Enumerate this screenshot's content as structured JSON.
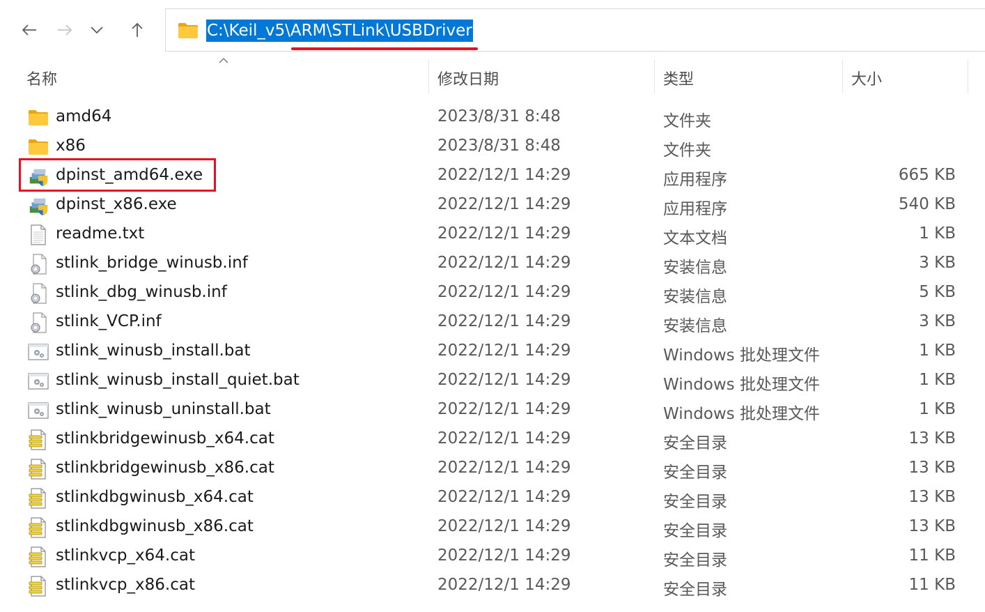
{
  "address_bar": {
    "path": "C:\\Keil_v5\\ARM\\STLink\\USBDriver"
  },
  "columns": {
    "name": "名称",
    "date": "修改日期",
    "type": "类型",
    "size": "大小"
  },
  "files": [
    {
      "name": "amd64",
      "date": "2023/8/31 8:48",
      "type": "文件夹",
      "size": "",
      "icon": "folder-icon"
    },
    {
      "name": "x86",
      "date": "2023/8/31 8:48",
      "type": "文件夹",
      "size": "",
      "icon": "folder-icon"
    },
    {
      "name": "dpinst_amd64.exe",
      "date": "2022/12/1 14:29",
      "type": "应用程序",
      "size": "665 KB",
      "icon": "installer-exe-icon"
    },
    {
      "name": "dpinst_x86.exe",
      "date": "2022/12/1 14:29",
      "type": "应用程序",
      "size": "540 KB",
      "icon": "installer-exe-icon"
    },
    {
      "name": "readme.txt",
      "date": "2022/12/1 14:29",
      "type": "文本文档",
      "size": "1 KB",
      "icon": "text-file-icon"
    },
    {
      "name": "stlink_bridge_winusb.inf",
      "date": "2022/12/1 14:29",
      "type": "安装信息",
      "size": "3 KB",
      "icon": "setup-info-icon"
    },
    {
      "name": "stlink_dbg_winusb.inf",
      "date": "2022/12/1 14:29",
      "type": "安装信息",
      "size": "5 KB",
      "icon": "setup-info-icon"
    },
    {
      "name": "stlink_VCP.inf",
      "date": "2022/12/1 14:29",
      "type": "安装信息",
      "size": "3 KB",
      "icon": "setup-info-icon"
    },
    {
      "name": "stlink_winusb_install.bat",
      "date": "2022/12/1 14:29",
      "type": "Windows 批处理文件",
      "size": "1 KB",
      "icon": "batch-file-icon"
    },
    {
      "name": "stlink_winusb_install_quiet.bat",
      "date": "2022/12/1 14:29",
      "type": "Windows 批处理文件",
      "size": "1 KB",
      "icon": "batch-file-icon"
    },
    {
      "name": "stlink_winusb_uninstall.bat",
      "date": "2022/12/1 14:29",
      "type": "Windows 批处理文件",
      "size": "1 KB",
      "icon": "batch-file-icon"
    },
    {
      "name": "stlinkbridgewinusb_x64.cat",
      "date": "2022/12/1 14:29",
      "type": "安全目录",
      "size": "13 KB",
      "icon": "security-catalog-icon"
    },
    {
      "name": "stlinkbridgewinusb_x86.cat",
      "date": "2022/12/1 14:29",
      "type": "安全目录",
      "size": "13 KB",
      "icon": "security-catalog-icon"
    },
    {
      "name": "stlinkdbgwinusb_x64.cat",
      "date": "2022/12/1 14:29",
      "type": "安全目录",
      "size": "13 KB",
      "icon": "security-catalog-icon"
    },
    {
      "name": "stlinkdbgwinusb_x86.cat",
      "date": "2022/12/1 14:29",
      "type": "安全目录",
      "size": "13 KB",
      "icon": "security-catalog-icon"
    },
    {
      "name": "stlinkvcp_x64.cat",
      "date": "2022/12/1 14:29",
      "type": "安全目录",
      "size": "11 KB",
      "icon": "security-catalog-icon"
    },
    {
      "name": "stlinkvcp_x86.cat",
      "date": "2022/12/1 14:29",
      "type": "安全目录",
      "size": "11 KB",
      "icon": "security-catalog-icon"
    }
  ]
}
